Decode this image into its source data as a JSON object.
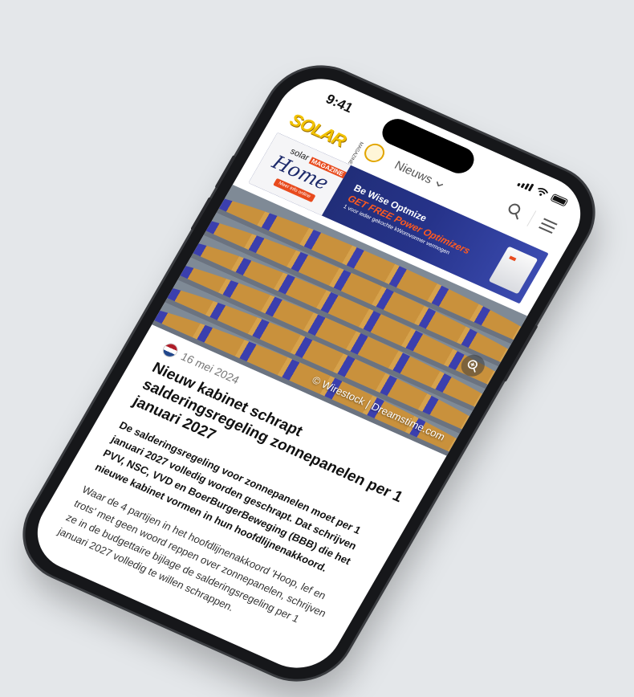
{
  "status_bar": {
    "time": "9:41"
  },
  "header": {
    "logo_text": "SOLAR",
    "logo_sub": "MAGAZINE",
    "nav_label": "Nieuws"
  },
  "banner": {
    "brand_top": "solar",
    "brand_badge": "MAGAZINE",
    "brand_script": "Home",
    "cta": "Meer info online",
    "headline": "Be Wise Optmize",
    "offer": "GET FREE Power Optimizers",
    "note": "1 voor ieder gekochte kWomvormer vermogen"
  },
  "hero": {
    "credit": "© Wirestock | Dreamstime.com"
  },
  "article": {
    "date": "16 mei 2024",
    "title": "Nieuw kabinet schrapt salderingsregeling zonnepanelen per 1 januari 2027",
    "lead": "De salderingsregeling voor zonnepanelen moet per 1 januari 2027 volledig worden geschrapt. Dat schrijven PVV, NSC, VVD en BoerBurgerBeweging (BBB) die het nieuwe kabinet vormen in hun hoofdlijnenakkoord.",
    "body": "Waar de 4 partijen in het hoofdlijnenakkoord 'Hoop, lef en trots' met geen woord reppen over zonnepanelen, schrijven ze in de budgettaire bijlage de salderingsregeling per 1 januari 2027 volledig te willen schrappen."
  },
  "colors": {
    "logo": "#f2c200",
    "banner_bg": "#1d2a6b",
    "banner_accent": "#e84b1e",
    "nl_red": "#ae1c28",
    "nl_blue": "#21468b"
  },
  "icons": [
    "signal-icon",
    "wifi-icon",
    "battery-icon",
    "chevron-down-icon",
    "search-icon",
    "menu-icon",
    "zoom-in-icon",
    "flag-nl-icon"
  ]
}
